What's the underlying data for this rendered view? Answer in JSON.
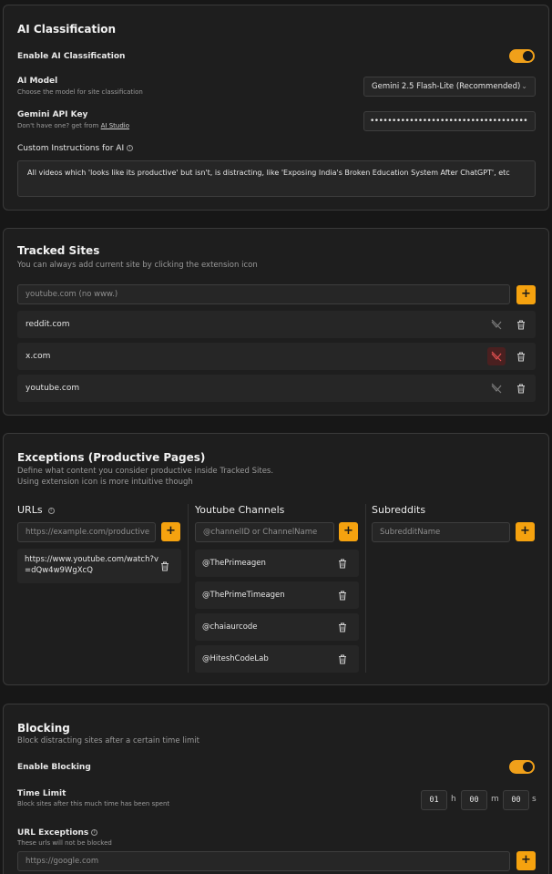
{
  "ai": {
    "title": "AI Classification",
    "enable_label": "Enable AI Classification",
    "enable_on": true,
    "model_label": "AI Model",
    "model_hint": "Choose the model for site classification",
    "model_value": "Gemini 2.5 Flash-Lite (Recommended)",
    "key_label": "Gemini API Key",
    "key_hint_prefix": "Don't have one? get from",
    "key_hint_link": "AI Studio",
    "key_value": "••••••••••••••••••••••••••••••••••••",
    "instructions_label": "Custom Instructions for AI",
    "instructions_value": "All videos which 'looks like its productive' but isn't, is distracting, like 'Exposing India's Broken Education System After ChatGPT', etc"
  },
  "tracked": {
    "title": "Tracked Sites",
    "subtitle": "You can always add current site by clicking the extension icon",
    "placeholder": "youtube.com (no www.)",
    "add_label": "+",
    "sites": [
      {
        "name": "reddit.com",
        "ai_off": false
      },
      {
        "name": "x.com",
        "ai_off": true
      },
      {
        "name": "youtube.com",
        "ai_off": false
      }
    ]
  },
  "exceptions": {
    "title": "Exceptions (Productive Pages)",
    "subtitle1": "Define what content you consider productive inside Tracked Sites.",
    "subtitle2": "Using extension icon is more intuitive though",
    "urls_title": "URLs",
    "urls_placeholder": "https://example.com/productive",
    "urls": [
      "https://www.youtube.com/watch?v=dQw4w9WgXcQ"
    ],
    "channels_title": "Youtube Channels",
    "channels_placeholder": "@channelID or ChannelName",
    "channels": [
      "@ThePrimeagen",
      "@ThePrimeTimeagen",
      "@chaiaurcode",
      "@HiteshCodeLab"
    ],
    "subreddits_title": "Subreddits",
    "subreddits_placeholder": "SubredditName",
    "add_label": "+"
  },
  "blocking": {
    "title": "Blocking",
    "subtitle": "Block distracting sites after a certain time limit",
    "enable_label": "Enable Blocking",
    "enable_on": true,
    "time_label": "Time Limit",
    "time_hint": "Block sites after this much time has been spent",
    "hours": "01",
    "minutes": "00",
    "seconds": "00",
    "unit_h": "h",
    "unit_m": "m",
    "unit_s": "s",
    "exceptions_label": "URL Exceptions",
    "exceptions_hint": "These urls will not be blocked",
    "exceptions_placeholder": "https://google.com",
    "add_label": "+"
  },
  "colors": {
    "accent": "#f5a20f",
    "panel": "#1e1e1e",
    "background": "#171717",
    "danger_bg": "#4a2020"
  }
}
